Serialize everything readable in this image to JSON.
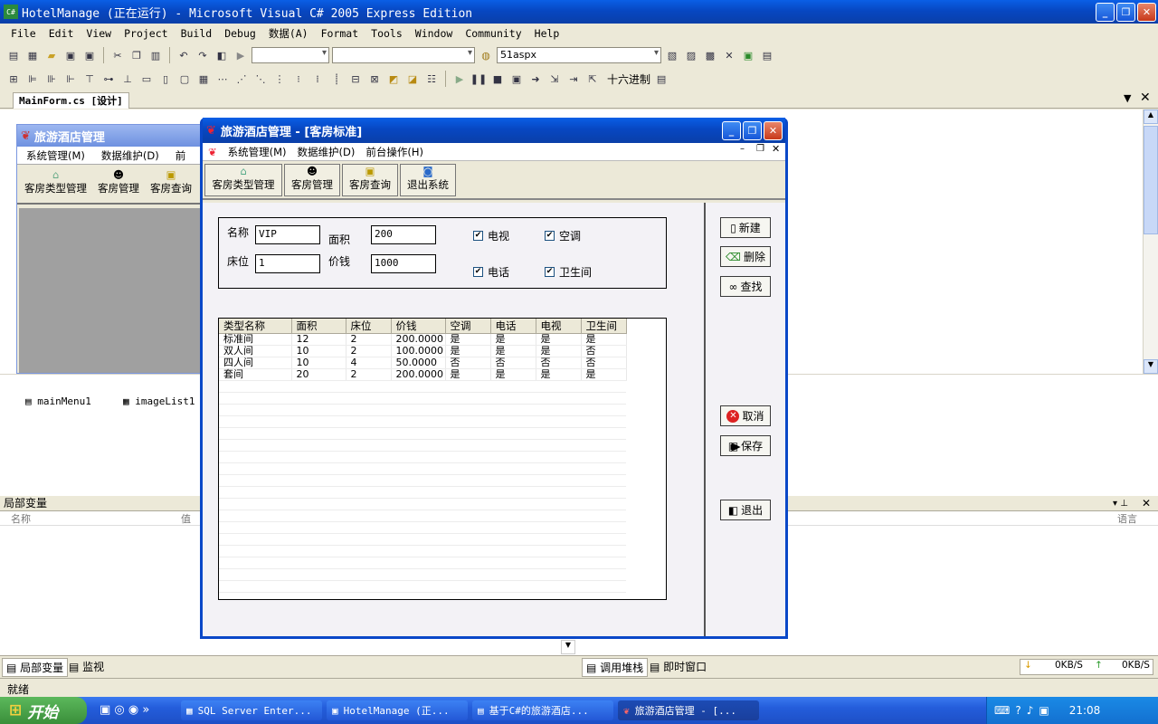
{
  "ide": {
    "title": "HotelManage (正在运行) - Microsoft Visual C# 2005 Express Edition",
    "menu": [
      "File",
      "Edit",
      "View",
      "Project",
      "Build",
      "Debug",
      "数据(A)",
      "Format",
      "Tools",
      "Window",
      "Community",
      "Help"
    ],
    "combo_project": "51aspx",
    "hex_label": "十六进制",
    "doc_tab": "MainForm.cs [设计]",
    "components": [
      "mainMenu1",
      "imageList1"
    ],
    "locals_title": "局部变量",
    "locals_col_name": "名称",
    "locals_col_value": "值",
    "locals_col_lang": "语言",
    "bottom_tabs": [
      "局部变量",
      "监视",
      "调用堆栈",
      "即时窗口"
    ],
    "net_down": "0KB/S",
    "net_up": "0KB/S",
    "status": "就绪"
  },
  "bg_form": {
    "title": "旅游酒店管理",
    "menu": [
      "系统管理(M)",
      "数据维护(D)",
      "前"
    ],
    "tools": [
      "客房类型管理",
      "客房管理",
      "客房查询"
    ]
  },
  "dialog": {
    "title": "旅游酒店管理 - [客房标准]",
    "menu": [
      "系统管理(M)",
      "数据维护(D)",
      "前台操作(H)"
    ],
    "tools": [
      "客房类型管理",
      "客房管理",
      "客房查询",
      "退出系统"
    ],
    "labels": {
      "name": "名称",
      "area": "面积",
      "bed": "床位",
      "price": "价钱"
    },
    "values": {
      "name": "VIP",
      "area": "200",
      "bed": "1",
      "price": "1000"
    },
    "checks": [
      "电视",
      "空调",
      "电话",
      "卫生间"
    ],
    "buttons": {
      "new": "新建",
      "delete": "删除",
      "find": "查找",
      "cancel": "取消",
      "save": "保存",
      "exit": "退出"
    },
    "columns": [
      "类型名称",
      "面积",
      "床位",
      "价钱",
      "空调",
      "电话",
      "电视",
      "卫生间"
    ],
    "rows": [
      [
        "标准间",
        "12",
        "2",
        "200.0000",
        "是",
        "是",
        "是",
        "是"
      ],
      [
        "双人间",
        "10",
        "2",
        "100.0000",
        "是",
        "是",
        "是",
        "否"
      ],
      [
        "四人间",
        "10",
        "4",
        "50.0000",
        "否",
        "否",
        "否",
        "否"
      ],
      [
        "套间",
        "20",
        "2",
        "200.0000",
        "是",
        "是",
        "是",
        "是"
      ]
    ]
  },
  "taskbar": {
    "start": "开始",
    "items": [
      "SQL Server Enter...",
      "HotelManage (正...",
      "基于C#的旅游酒店...",
      "旅游酒店管理 - [..."
    ],
    "clock": "21:08"
  }
}
